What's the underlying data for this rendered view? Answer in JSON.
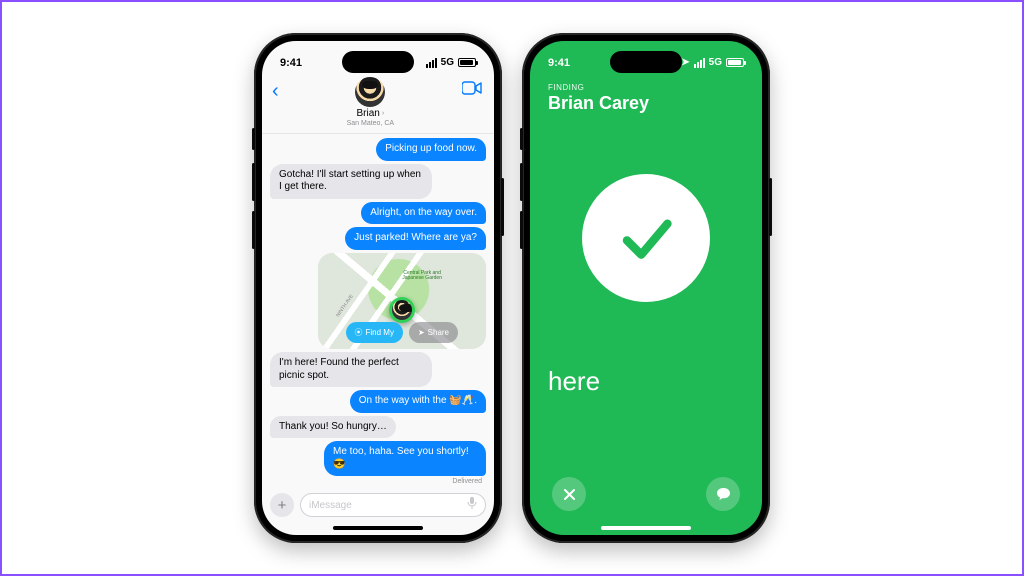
{
  "status": {
    "time": "9:41",
    "network": "5G"
  },
  "messages": {
    "contact_name": "Brian",
    "contact_location": "San Mateo, CA",
    "bubbles": {
      "m1": "Picking up food now.",
      "m2": "Gotcha! I'll start setting up when I get there.",
      "m3": "Alright, on the way over.",
      "m4": "Just parked! Where are ya?",
      "m5": "I'm here! Found the perfect picnic spot.",
      "m6": "On the way with the 🧺🥂.",
      "m7": "Thank you! So hungry…",
      "m8": "Me too, haha. See you shortly! 😎"
    },
    "map": {
      "poi": "Central Park and\nJapanese Garden",
      "street": "NINTH AVE",
      "findmy_label": "Find My",
      "share_label": "Share"
    },
    "delivered": "Delivered",
    "input_placeholder": "iMessage"
  },
  "findmy": {
    "finding": "FINDING",
    "name": "Brian Carey",
    "status": "here"
  }
}
